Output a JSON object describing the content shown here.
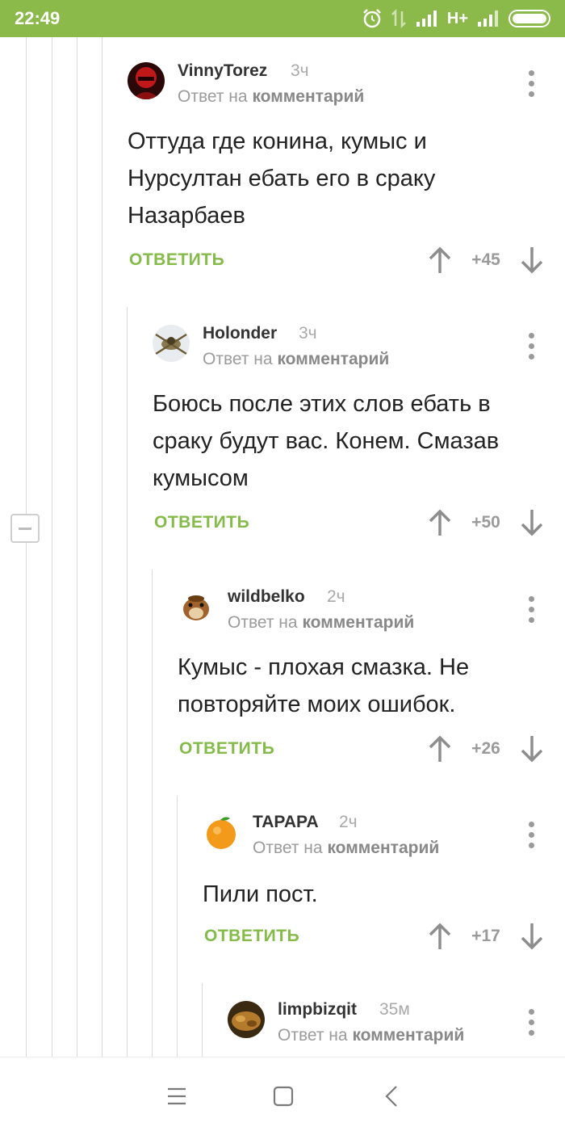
{
  "status_bar": {
    "time": "22:49",
    "network_type": "H+",
    "icons": [
      "alarm-icon",
      "data-transfer-icon",
      "signal-icon",
      "battery-icon"
    ]
  },
  "colors": {
    "status_bar": "#8bb94a",
    "reply_accent": "#84bb49",
    "muted_text": "#a9a9a9"
  },
  "reply_label": "ОТВЕТИТЬ",
  "comments": [
    {
      "author": "VinnyTorez",
      "time": "3ч",
      "reply_prefix": "Ответ на",
      "reply_target": "комментарий",
      "text_lines": [
        "Оттуда где конина, кумыс и",
        "Нурсултан ебать его в сраку",
        "Назарбаев"
      ],
      "score": "+45"
    },
    {
      "author": "Holonder",
      "time": "3ч",
      "reply_prefix": "Ответ на",
      "reply_target": "комментарий",
      "text_lines": [
        "Боюсь после этих слов ебать в",
        "сраку будут вас. Конем. Смазав",
        "кумысом"
      ],
      "score": "+50"
    },
    {
      "author": "wildbelko",
      "time": "2ч",
      "reply_prefix": "Ответ на",
      "reply_target": "комментарий",
      "text_lines": [
        "Кумыс - плохая смазка. Не",
        "повторяйте моих ошибок."
      ],
      "score": "+26"
    },
    {
      "author": "TAPAPA",
      "time": "2ч",
      "reply_prefix": "Ответ на",
      "reply_target": "комментарий",
      "text_lines": [
        "Пили пост."
      ],
      "score": "+17"
    },
    {
      "author": "limpbizqit",
      "time": "35м",
      "reply_prefix": "Ответ на",
      "reply_target": "комментарий"
    }
  ],
  "nav": {
    "icons": [
      "menu-icon",
      "home-square-icon",
      "back-icon"
    ]
  }
}
